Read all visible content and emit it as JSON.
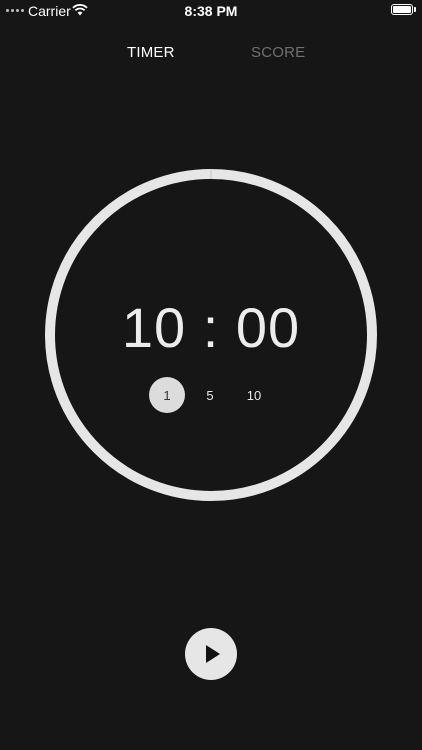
{
  "status_bar": {
    "carrier": "Carrier",
    "time": "8:38 PM",
    "icons": [
      "signal-dots-icon",
      "wifi-icon",
      "battery-icon"
    ]
  },
  "tabs": [
    {
      "label": "TIMER",
      "active": true
    },
    {
      "label": "SCORE",
      "active": false
    }
  ],
  "timer": {
    "display": "10 : 00",
    "minute_options": [
      {
        "label": "1",
        "selected": true
      },
      {
        "label": "5",
        "selected": false
      },
      {
        "label": "10",
        "selected": false
      }
    ],
    "ring_color": "#e6e6e6"
  },
  "controls": {
    "play_icon": "play-icon"
  },
  "colors": {
    "background": "#161616",
    "active_tab": "#ffffff",
    "inactive_tab": "#6f6f6f",
    "accent": "#e6e6e6"
  }
}
